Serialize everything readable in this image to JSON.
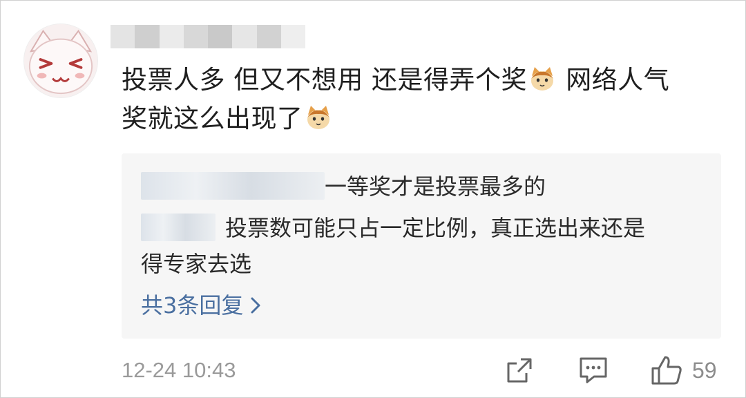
{
  "comment": {
    "line1": "投票人多 但又不想用 还是得弄个奖",
    "line1b": "网络人气",
    "line2": "奖就这么出现了",
    "emoji_name": "cat-face-emoji"
  },
  "reply": {
    "line1_text": "一等奖才是投票最多的",
    "line2_text": "投票数可能只占一定比例，真正选出来还是",
    "line3_text": "得专家去选",
    "more_label": "共3条回复"
  },
  "footer": {
    "timestamp": "12-24 10:43",
    "like_count": "59"
  },
  "icons": {
    "share": "share-icon",
    "comment": "comment-icon",
    "like": "thumbs-up-icon"
  },
  "colors": {
    "link": "#4a6fa0",
    "muted": "#9a9a9a",
    "reply_bg": "#f6f6f6"
  }
}
